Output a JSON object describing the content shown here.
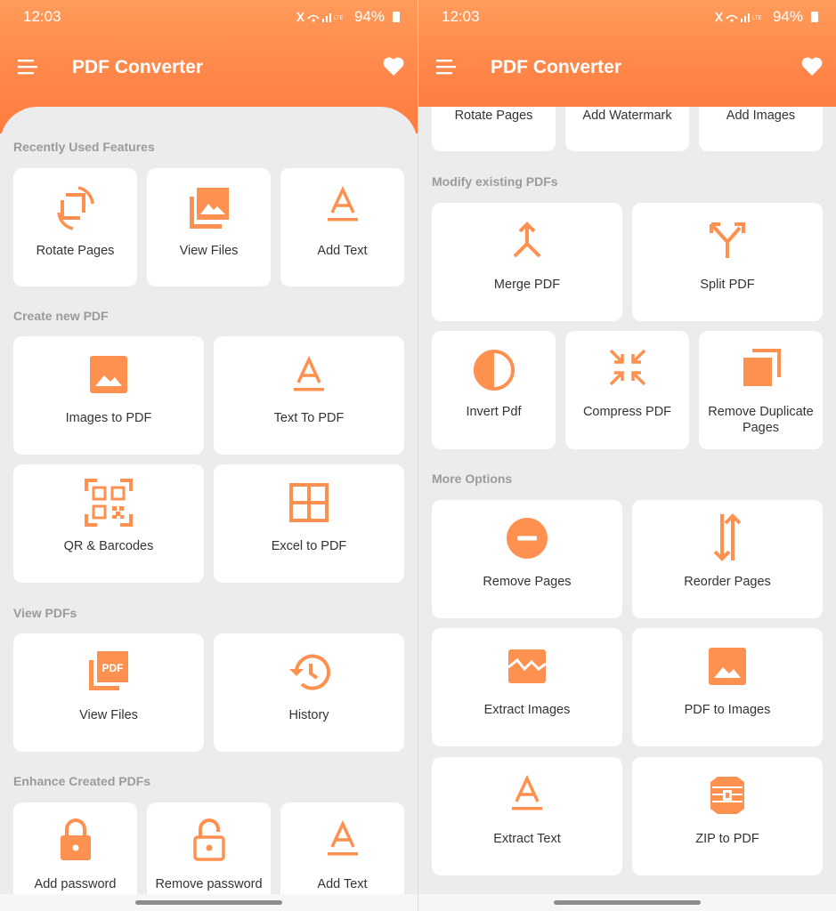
{
  "status": {
    "time": "12:03",
    "battery": "94%"
  },
  "app": {
    "title": "PDF Converter"
  },
  "colors": {
    "accent": "#ff8a4c",
    "icon": "#ff9150",
    "section": "#9b9b9b"
  },
  "left": {
    "recent": {
      "header": "Recently Used Features",
      "items": [
        {
          "label": "Rotate Pages",
          "icon": "rotate-icon"
        },
        {
          "label": "View Files",
          "icon": "gallery-icon"
        },
        {
          "label": "Add Text",
          "icon": "text-icon"
        }
      ]
    },
    "create": {
      "header": "Create new PDF",
      "items": [
        {
          "label": "Images to PDF",
          "icon": "image-icon"
        },
        {
          "label": "Text To PDF",
          "icon": "text-icon"
        },
        {
          "label": "QR & Barcodes",
          "icon": "qr-icon"
        },
        {
          "label": "Excel to PDF",
          "icon": "grid-icon"
        }
      ]
    },
    "view": {
      "header": "View PDFs",
      "items": [
        {
          "label": "View Files",
          "icon": "pdf-file-icon"
        },
        {
          "label": "History",
          "icon": "history-icon"
        }
      ]
    },
    "enhance": {
      "header": "Enhance Created PDFs",
      "items": [
        {
          "label": "Add password",
          "icon": "lock-icon"
        },
        {
          "label": "Remove password",
          "icon": "unlock-icon"
        },
        {
          "label": "Add Text",
          "icon": "text-icon"
        }
      ]
    }
  },
  "right": {
    "enhance_partial": {
      "items": [
        {
          "label": "Rotate Pages"
        },
        {
          "label": "Add Watermark"
        },
        {
          "label": "Add Images"
        }
      ]
    },
    "modify": {
      "header": "Modify existing PDFs",
      "items": [
        {
          "label": "Merge PDF",
          "icon": "merge-icon"
        },
        {
          "label": "Split PDF",
          "icon": "split-icon"
        },
        {
          "label": "Invert Pdf",
          "icon": "invert-icon"
        },
        {
          "label": "Compress PDF",
          "icon": "compress-icon"
        },
        {
          "label": "Remove Duplicate Pages",
          "icon": "duplicate-icon"
        }
      ]
    },
    "more": {
      "header": "More Options",
      "items": [
        {
          "label": "Remove Pages",
          "icon": "remove-icon"
        },
        {
          "label": "Reorder Pages",
          "icon": "reorder-icon"
        },
        {
          "label": "Extract Images",
          "icon": "broken-image-icon"
        },
        {
          "label": "PDF to Images",
          "icon": "image-icon"
        },
        {
          "label": "Extract Text",
          "icon": "text-icon"
        },
        {
          "label": "ZIP to PDF",
          "icon": "zip-icon"
        }
      ]
    }
  }
}
